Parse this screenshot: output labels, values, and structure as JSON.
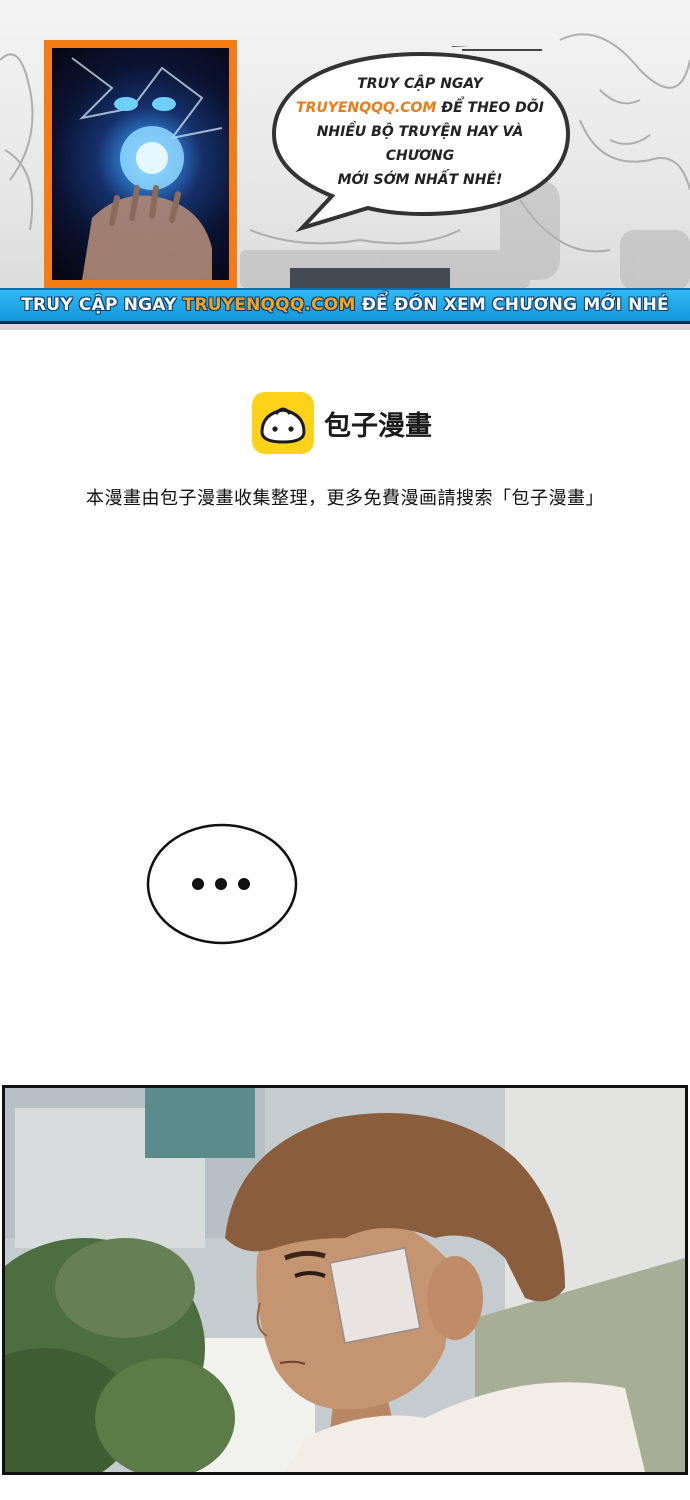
{
  "promo_banner": {
    "bubble_line1": "TRUY CẬP NGAY",
    "bubble_site": "TRUYENQQQ.COM",
    "bubble_line2_rest": " ĐỂ THEO DÕI",
    "bubble_line3": "NHIỀU BỘ TRUYỆN HAY VÀ CHƯƠNG",
    "bubble_line4": "MỚI SỚM NHẤT NHÉ!",
    "strip_prefix": "TRUY CẬP NGAY ",
    "strip_site": "TRUYENQQQ.COM",
    "strip_suffix": " ĐỂ ĐÓN XEM CHƯƠNG MỚI NHÉ",
    "accent_color": "#f07a14",
    "strip_color": "#1596dd"
  },
  "notice": {
    "brand_name": "包子漫畫",
    "text": "本漫畫由包子漫畫收集整理，更多免費漫画請搜索「包子漫畫」"
  },
  "speech_bubble": {
    "text": "..."
  },
  "icons": {
    "logo": "steamed-bun-logo-icon"
  }
}
